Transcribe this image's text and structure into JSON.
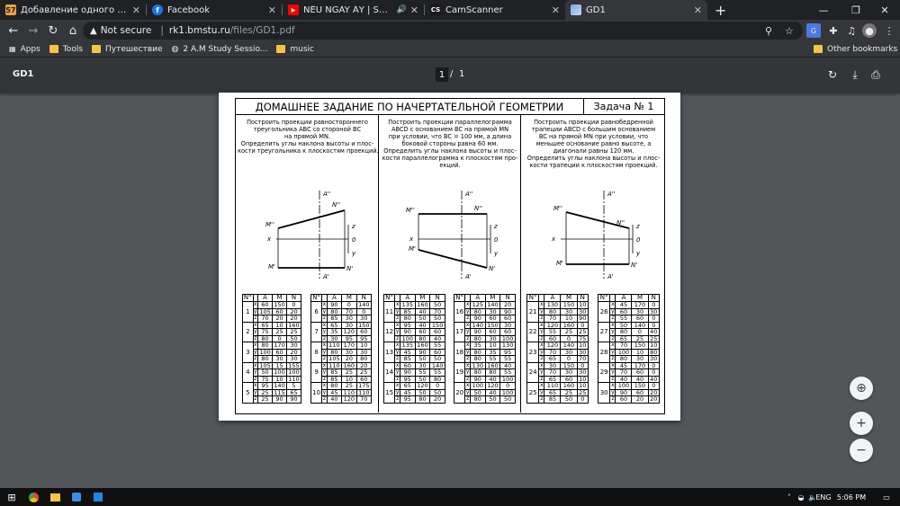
{
  "browser": {
    "tabs": [
      {
        "title": "Добавление одного файла » Сч",
        "icon": "cscamp-icon",
        "icon_text": "57",
        "active": false
      },
      {
        "title": "Facebook",
        "icon": "facebook-icon",
        "icon_text": "f",
        "active": false
      },
      {
        "title": "NẾU NGÀY ẤY | SOOBIN HO",
        "icon": "youtube-icon",
        "icon_text": "▶",
        "active": false
      },
      {
        "title": "CamScanner",
        "icon": "camscanner-icon",
        "icon_text": "CS",
        "active": false
      },
      {
        "title": "GD1",
        "icon": "pdf-tab-icon",
        "icon_text": "",
        "active": true
      }
    ],
    "new_tab": "+",
    "address": {
      "security": "Not secure",
      "host": "rk1.bmstu.ru",
      "path": "/files/GD1.pdf"
    },
    "bookmarks": [
      {
        "label": "Apps",
        "icon": "apps-icon"
      },
      {
        "label": "Tools",
        "icon": "folder-icon"
      },
      {
        "label": "Путешествие",
        "icon": "folder-icon"
      },
      {
        "label": "2 A.M Study Sessio...",
        "icon": "globe-icon"
      },
      {
        "label": "music",
        "icon": "folder-icon"
      }
    ],
    "other_bookmarks": "Other bookmarks"
  },
  "pdf_viewer": {
    "title": "GD1",
    "page_current": "1",
    "page_sep": "/",
    "page_total": "1"
  },
  "document": {
    "title": "ДОМАШНЕЕ ЗАДАНИЕ ПО НАЧЕРТАТЕЛЬНОЙ ГЕОМЕТРИИ",
    "task": "Задача № 1",
    "columns": [
      {
        "text": [
          "Построить проекции равностороннего",
          "треугольника  ABC  со  стороной ВС",
          "на прямой MN.",
          "Определить углы наклона высоты и плос-",
          "кости треугольника к плоскостям проекций."
        ],
        "diagram_labels": {
          "a2": "A''",
          "n2": "N''",
          "m2": "M''",
          "z": "z",
          "x": "x",
          "o": "0",
          "y": "y",
          "m1": "M'",
          "n1": "N'",
          "a1": "A'"
        }
      },
      {
        "text": [
          "Построить проекции параллелограмма",
          "ABCD с основанием BC на прямой MN",
          "при условии, что BC = 100 мм, а длина",
          "боковой стороны равна 60 мм.",
          "Определить углы наклона высоты и плос-",
          "кости параллелограмма к плоскостям про-",
          "екций."
        ],
        "diagram_labels": {
          "a2": "A''",
          "n2": "N''",
          "m2": "M''",
          "z": "z",
          "x": "x",
          "o": "0",
          "y": "y",
          "m1": "M'",
          "n1": "N'",
          "a1": "A'"
        }
      },
      {
        "text": [
          "Построить проекции   равнобедренной",
          "трапеции ABCD с большим основанием",
          "BC  на  прямой MN   при  условии,  что",
          "меньшее  основание  равно  высоте,  а",
          "диагонали равны 120 мм.",
          "Определить углы наклона высоты и плос-",
          "кости трапеции к плоскостям проекций."
        ],
        "diagram_labels": {
          "a2": "A''",
          "n2": "N''",
          "m2": "M''",
          "z": "z",
          "x": "x",
          "o": "0",
          "y": "y",
          "m1": "M'",
          "n1": "N'",
          "a1": "A'"
        }
      }
    ],
    "table_head": [
      "N°",
      "",
      "A",
      "M",
      "N"
    ],
    "variants": [
      {
        "n": "1",
        "x": [
          "60",
          "150",
          "0"
        ],
        "y": [
          "105",
          "60",
          "20"
        ],
        "z": [
          "70",
          "20",
          "20"
        ]
      },
      {
        "n": "2",
        "x": [
          "65",
          "10",
          "160"
        ],
        "y": [
          "75",
          "25",
          "25"
        ],
        "z": [
          "80",
          "0",
          "50"
        ]
      },
      {
        "n": "3",
        "x": [
          "80",
          "170",
          "30"
        ],
        "y": [
          "100",
          "60",
          "20"
        ],
        "z": [
          "80",
          "30",
          "30"
        ]
      },
      {
        "n": "4",
        "x": [
          "105",
          "15",
          "155"
        ],
        "y": [
          "50",
          "100",
          "100"
        ],
        "z": [
          "75",
          "10",
          "110"
        ]
      },
      {
        "n": "5",
        "x": [
          "95",
          "140",
          "5"
        ],
        "y": [
          "25",
          "115",
          "65"
        ],
        "z": [
          "25",
          "90",
          "90"
        ]
      },
      {
        "n": "6",
        "x": [
          "90",
          "0",
          "140"
        ],
        "y": [
          "80",
          "70",
          "0"
        ],
        "z": [
          "85",
          "30",
          "30"
        ]
      },
      {
        "n": "7",
        "x": [
          "65",
          "30",
          "150"
        ],
        "y": [
          "35",
          "120",
          "60"
        ],
        "z": [
          "30",
          "95",
          "95"
        ]
      },
      {
        "n": "8",
        "x": [
          "110",
          "170",
          "10"
        ],
        "y": [
          "80",
          "30",
          "30"
        ],
        "z": [
          "105",
          "20",
          "80"
        ]
      },
      {
        "n": "9",
        "x": [
          "110",
          "160",
          "20"
        ],
        "y": [
          "85",
          "25",
          "25"
        ],
        "z": [
          "85",
          "10",
          "60"
        ]
      },
      {
        "n": "10",
        "x": [
          "80",
          "25",
          "175"
        ],
        "y": [
          "45",
          "110",
          "110"
        ],
        "z": [
          "40",
          "120",
          "70"
        ]
      },
      {
        "n": "11",
        "x": [
          "135",
          "160",
          "50"
        ],
        "y": [
          "85",
          "40",
          "70"
        ],
        "z": [
          "80",
          "50",
          "50"
        ]
      },
      {
        "n": "12",
        "x": [
          "95",
          "40",
          "150"
        ],
        "y": [
          "90",
          "60",
          "60"
        ],
        "z": [
          "100",
          "80",
          "40"
        ]
      },
      {
        "n": "13",
        "x": [
          "135",
          "160",
          "55"
        ],
        "y": [
          "45",
          "90",
          "60"
        ],
        "z": [
          "85",
          "50",
          "50"
        ]
      },
      {
        "n": "14",
        "x": [
          "60",
          "30",
          "140"
        ],
        "y": [
          "90",
          "55",
          "55"
        ],
        "z": [
          "95",
          "50",
          "80"
        ]
      },
      {
        "n": "15",
        "x": [
          "65",
          "120",
          "0"
        ],
        "y": [
          "45",
          "50",
          "50"
        ],
        "z": [
          "95",
          "80",
          "20"
        ]
      },
      {
        "n": "16",
        "x": [
          "125",
          "140",
          "20"
        ],
        "y": [
          "80",
          "30",
          "90"
        ],
        "z": [
          "90",
          "60",
          "60"
        ]
      },
      {
        "n": "17",
        "x": [
          "140",
          "150",
          "30"
        ],
        "y": [
          "90",
          "60",
          "60"
        ],
        "z": [
          "80",
          "30",
          "100"
        ]
      },
      {
        "n": "18",
        "x": [
          "35",
          "10",
          "130"
        ],
        "y": [
          "80",
          "35",
          "95"
        ],
        "z": [
          "80",
          "55",
          "55"
        ]
      },
      {
        "n": "19",
        "x": [
          "130",
          "160",
          "40"
        ],
        "y": [
          "80",
          "80",
          "55"
        ],
        "z": [
          "90",
          "40",
          "100"
        ]
      },
      {
        "n": "20",
        "x": [
          "100",
          "120",
          "0"
        ],
        "y": [
          "50",
          "40",
          "100"
        ],
        "z": [
          "80",
          "50",
          "50"
        ]
      },
      {
        "n": "21",
        "x": [
          "130",
          "150",
          "10"
        ],
        "y": [
          "80",
          "30",
          "30"
        ],
        "z": [
          "70",
          "10",
          "90"
        ]
      },
      {
        "n": "22",
        "x": [
          "120",
          "160",
          "0"
        ],
        "y": [
          "55",
          "25",
          "25"
        ],
        "z": [
          "60",
          "0",
          "75"
        ]
      },
      {
        "n": "23",
        "x": [
          "120",
          "140",
          "10"
        ],
        "y": [
          "70",
          "30",
          "30"
        ],
        "z": [
          "65",
          "0",
          "70"
        ]
      },
      {
        "n": "24",
        "x": [
          "30",
          "150",
          "0"
        ],
        "y": [
          "70",
          "30",
          "30"
        ],
        "z": [
          "65",
          "60",
          "10"
        ]
      },
      {
        "n": "25",
        "x": [
          "110",
          "160",
          "10"
        ],
        "y": [
          "65",
          "25",
          "25"
        ],
        "z": [
          "85",
          "50",
          "0"
        ]
      },
      {
        "n": "26",
        "x": [
          "45",
          "170",
          "0"
        ],
        "y": [
          "60",
          "30",
          "30"
        ],
        "z": [
          "55",
          "60",
          "0"
        ]
      },
      {
        "n": "27",
        "x": [
          "50",
          "140",
          "0"
        ],
        "y": [
          "80",
          "0",
          "40"
        ],
        "z": [
          "65",
          "25",
          "25"
        ]
      },
      {
        "n": "28",
        "x": [
          "70",
          "150",
          "10"
        ],
        "y": [
          "100",
          "10",
          "80"
        ],
        "z": [
          "80",
          "30",
          "30"
        ]
      },
      {
        "n": "29",
        "x": [
          "45",
          "170",
          "0"
        ],
        "y": [
          "70",
          "60",
          "0"
        ],
        "z": [
          "40",
          "40",
          "40"
        ]
      },
      {
        "n": "30",
        "x": [
          "100",
          "150",
          "0"
        ],
        "y": [
          "90",
          "60",
          "20"
        ],
        "z": [
          "60",
          "20",
          "20"
        ]
      }
    ]
  },
  "taskbar": {
    "lang": "ENG",
    "time": "5:06 PM"
  },
  "colors": {
    "chrome_dark": "#202124",
    "chrome_bar": "#35363a",
    "pdf_bg": "#525659",
    "pdf_toolbar": "#323639"
  }
}
